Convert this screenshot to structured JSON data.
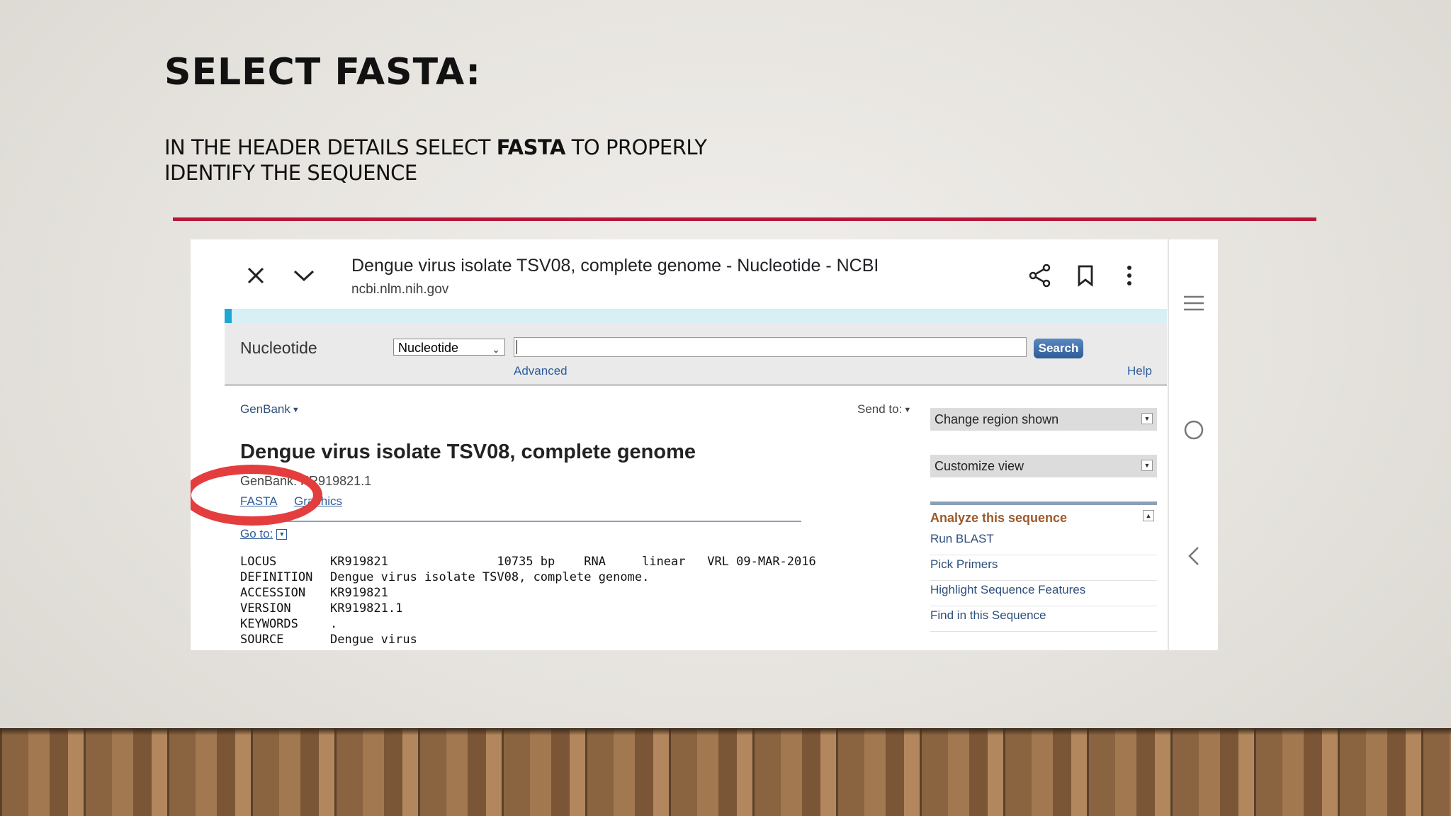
{
  "slide": {
    "title": "SELECT FASTA:",
    "subtitle_pre": "IN THE HEADER DETAILS SELECT ",
    "subtitle_bold": "FASTA",
    "subtitle_post1": " TO PROPERLY",
    "subtitle_line2": "IDENTIFY THE SEQUENCE",
    "accent_color": "#b5193a"
  },
  "browser": {
    "page_title": "Dengue virus isolate TSV08, complete genome - Nucleotide - NCBI",
    "url": "ncbi.nlm.nih.gov",
    "icons": [
      "close-icon",
      "chevron-down-icon",
      "share-icon",
      "bookmark-icon",
      "more-vert-icon",
      "menu-icon",
      "circle-icon",
      "back-icon"
    ]
  },
  "search": {
    "db_label": "Nucleotide",
    "db_selected": "Nucleotide",
    "query_value": "",
    "button_label": "Search",
    "advanced_label": "Advanced",
    "help_label": "Help"
  },
  "record": {
    "format_menu": "GenBank",
    "send_to": "Send to:",
    "title": "Dengue virus isolate TSV08, complete genome",
    "genbank_id": "GenBank: KR919821.1",
    "fasta_link": "FASTA",
    "graphics_link": "Graphics",
    "goto_label": "Go to:",
    "fields": [
      {
        "key": "LOCUS",
        "value": "KR919821               10735 bp    RNA     linear   VRL 09-MAR-2016"
      },
      {
        "key": "DEFINITION",
        "value": "Dengue virus isolate TSV08, complete genome."
      },
      {
        "key": "ACCESSION",
        "value": "KR919821"
      },
      {
        "key": "VERSION",
        "value": "KR919821.1"
      },
      {
        "key": "KEYWORDS",
        "value": "."
      },
      {
        "key": "SOURCE",
        "value": "Dengue virus"
      }
    ]
  },
  "sidebar": {
    "change_region": "Change region shown",
    "customize_view": "Customize view",
    "analyze_title": "Analyze this sequence",
    "tools": [
      "Run BLAST",
      "Pick Primers",
      "Highlight Sequence Features",
      "Find in this Sequence"
    ]
  },
  "highlight": {
    "color": "#e43d3e",
    "target": "FASTA"
  }
}
